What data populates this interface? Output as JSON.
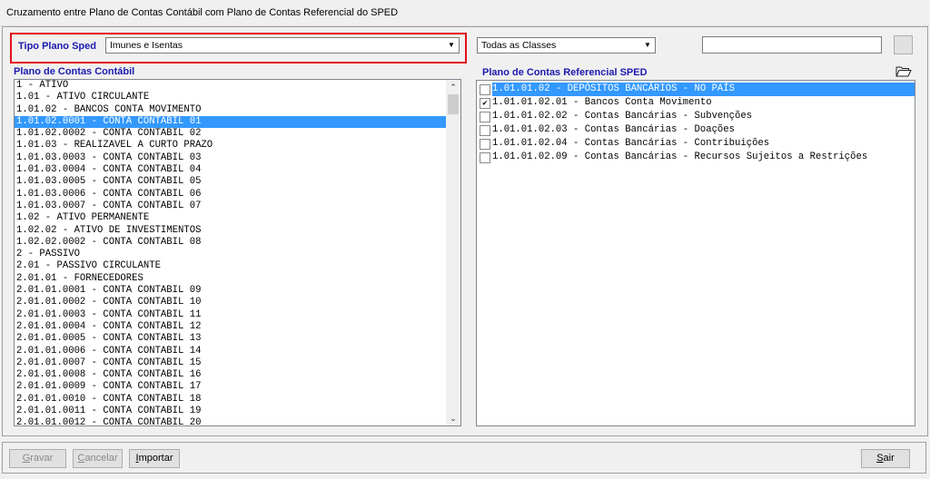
{
  "window": {
    "title": "Cruzamento entre Plano de Contas Contábil com Plano de Contas Referencial do SPED"
  },
  "tipo_plano": {
    "label": "Tipo Plano Sped",
    "value": "Imunes e Isentas"
  },
  "classes_combo": {
    "value": "Todas as Classes"
  },
  "search": {
    "value": ""
  },
  "left": {
    "header": "Plano de Contas Contábil",
    "selected_index": 3,
    "items": [
      "1 - ATIVO",
      "1.01 - ATIVO CIRCULANTE",
      "1.01.02 - BANCOS CONTA MOVIMENTO",
      "1.01.02.0001 - CONTA CONTABIL 01",
      "1.01.02.0002 - CONTA CONTABIL 02",
      "1.01.03 - REALIZAVEL A CURTO PRAZO",
      "1.01.03.0003 - CONTA CONTABIL 03",
      "1.01.03.0004 - CONTA CONTABIL 04",
      "1.01.03.0005 - CONTA CONTABIL 05",
      "1.01.03.0006 - CONTA CONTABIL 06",
      "1.01.03.0007 - CONTA CONTABIL 07",
      "1.02 - ATIVO PERMANENTE",
      "1.02.02 - ATIVO DE INVESTIMENTOS",
      "1.02.02.0002 - CONTA CONTABIL 08",
      "2 - PASSIVO",
      "2.01 - PASSIVO CIRCULANTE",
      "2.01.01 - FORNECEDORES",
      "2.01.01.0001 - CONTA CONTABIL 09",
      "2.01.01.0002 - CONTA CONTABIL 10",
      "2.01.01.0003 - CONTA CONTABIL 11",
      "2.01.01.0004 - CONTA CONTABIL 12",
      "2.01.01.0005 - CONTA CONTABIL 13",
      "2.01.01.0006 - CONTA CONTABIL 14",
      "2.01.01.0007 - CONTA CONTABIL 15",
      "2.01.01.0008 - CONTA CONTABIL 16",
      "2.01.01.0009 - CONTA CONTABIL 17",
      "2.01.01.0010 - CONTA CONTABIL 18",
      "2.01.01.0011 - CONTA CONTABIL 19",
      "2.01.01.0012 - CONTA CONTABIL 20"
    ]
  },
  "right": {
    "header": "Plano de Contas Referencial SPED",
    "items": [
      {
        "label": "1.01.01.02 - DEPÓSITOS BANCÁRIOS - NO PAÍS",
        "checked": false,
        "selected": true
      },
      {
        "label": "1.01.01.02.01 - Bancos Conta Movimento",
        "checked": true,
        "selected": false
      },
      {
        "label": "1.01.01.02.02 - Contas Bancárias - Subvenções",
        "checked": false,
        "selected": false
      },
      {
        "label": "1.01.01.02.03 - Contas Bancárias - Doações",
        "checked": false,
        "selected": false
      },
      {
        "label": "1.01.01.02.04 - Contas Bancárias - Contribuições",
        "checked": false,
        "selected": false
      },
      {
        "label": "1.01.01.02.09 - Contas Bancárias - Recursos Sujeitos a Restrições",
        "checked": false,
        "selected": false
      }
    ]
  },
  "buttons": {
    "gravar": {
      "first": "G",
      "rest": "ravar"
    },
    "cancelar": {
      "first": "C",
      "rest": "ancelar"
    },
    "importar": {
      "first": "I",
      "rest": "mportar"
    },
    "sair": {
      "first": "S",
      "rest": "air"
    }
  },
  "icons": {
    "folder": "open-folder-icon",
    "check": "✔"
  }
}
